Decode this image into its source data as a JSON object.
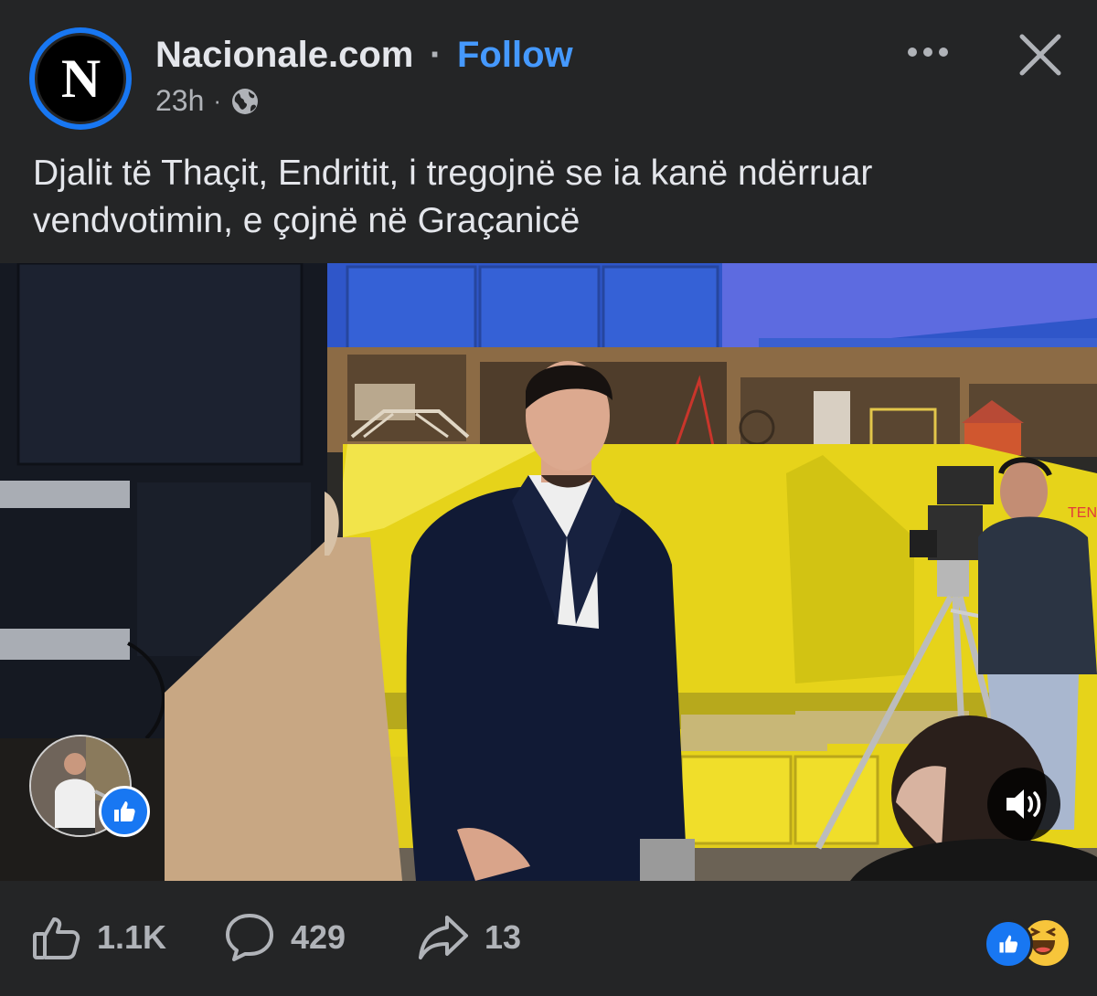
{
  "post": {
    "page_name": "Nacionale.com",
    "separator": "·",
    "follow_label": "Follow",
    "avatar_letter": "N",
    "time": "23h",
    "meta_dot": "·",
    "audience_icon": "globe-icon",
    "text": "Djalit të Thaçit, Endritit, i tregojnë se ia kanë ndërruar vendvotimin, e çojnë në Graçanicë"
  },
  "video": {
    "sound_icon": "volume-icon",
    "overlay_reaction_icon": "like-icon",
    "background_sign_text": "TENDA"
  },
  "footer": {
    "like_count": "1.1K",
    "comment_count": "429",
    "share_count": "13",
    "reactions": [
      "like",
      "haha"
    ]
  },
  "colors": {
    "background": "#242526",
    "text": "#e4e6eb",
    "muted": "#b0b3b8",
    "accent": "#4599ff",
    "brand_blue": "#1877f2"
  }
}
